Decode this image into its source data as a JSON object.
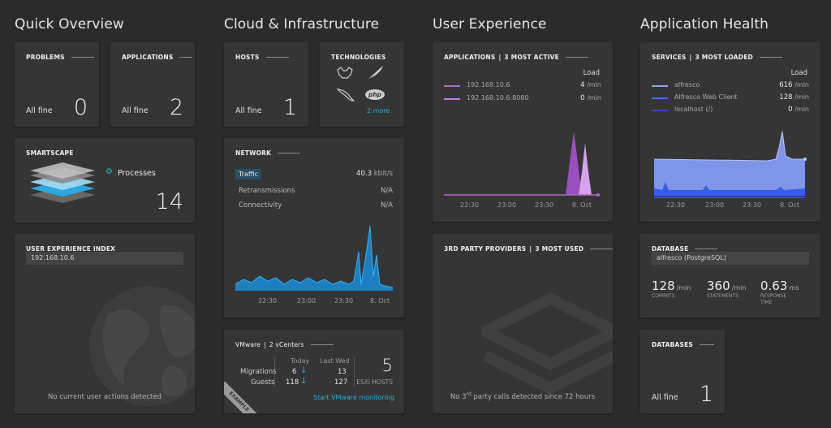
{
  "sections": {
    "quick_overview": "Quick Overview",
    "cloud": "Cloud & Infrastructure",
    "ux": "User Experience",
    "health": "Application Health"
  },
  "problems": {
    "title": "PROBLEMS",
    "status": "All fine",
    "count": "0"
  },
  "applications_count": {
    "title": "APPLICATIONS",
    "status": "All fine",
    "count": "2"
  },
  "smartscape": {
    "title": "SMARTSCAPE",
    "label": "Processes",
    "count": "14"
  },
  "uxi": {
    "title": "USER EXPERIENCE INDEX",
    "host": "192.168.10.6",
    "message": "No current user actions detected"
  },
  "hosts": {
    "title": "HOSTS",
    "status": "All fine",
    "count": "1"
  },
  "technologies": {
    "title": "TECHNOLOGIES",
    "more": "2 more",
    "php": "php"
  },
  "network": {
    "title": "NETWORK",
    "rows": [
      {
        "label": "Traffic",
        "value": "40.3",
        "unit": "kbit/s"
      },
      {
        "label": "Retransmissions",
        "value": "N/A",
        "unit": ""
      },
      {
        "label": "Connectivity",
        "value": "N/A",
        "unit": ""
      }
    ],
    "ticks": [
      "22:30",
      "23:00",
      "23:30",
      "8. Oct"
    ]
  },
  "vmware": {
    "title": "VMware",
    "subtitle": "2 vCenters",
    "col_today": "Today",
    "col_last": "Last Wed",
    "rows": [
      {
        "label": "Migrations",
        "today": "6",
        "last": "13"
      },
      {
        "label": "Guests",
        "today": "118",
        "last": "127"
      }
    ],
    "hosts_count": "5",
    "hosts_label": "ESXi HOSTS",
    "link": "Start VMware monitoring",
    "ribbon": "EXAMPLE"
  },
  "ux_apps": {
    "title": "APPLICATIONS",
    "subtitle": "3 MOST ACTIVE",
    "load_label": "Load",
    "rows": [
      {
        "name": "192.168.10.6",
        "value": "4",
        "unit": "/min",
        "color": "#b06ad0"
      },
      {
        "name": "192.168.10.6:8080",
        "value": "0",
        "unit": "/min",
        "color": "#c27fe0"
      }
    ],
    "ticks": [
      "22:30",
      "23:00",
      "23:30",
      "8. Oct"
    ]
  },
  "third_party": {
    "title": "3RD PARTY PROVIDERS",
    "subtitle": "3 MOST USED",
    "message_a": "No 3",
    "message_sup": "rd",
    "message_b": " party calls detected since 72 hours"
  },
  "services": {
    "title": "SERVICES",
    "subtitle": "3 MOST LOADED",
    "load_label": "Load",
    "rows": [
      {
        "name": "alfresco",
        "value": "616",
        "unit": "/min",
        "color": "#8ea2f2"
      },
      {
        "name": "Alfresco Web Client",
        "value": "128",
        "unit": "/min",
        "color": "#4a6ef0"
      },
      {
        "name": "localhost (/)",
        "value": "0",
        "unit": "/min",
        "color": "#3a3fc0"
      }
    ],
    "ticks": [
      "22:30",
      "23:00",
      "23:30",
      "8. Oct"
    ]
  },
  "database": {
    "title": "DATABASE",
    "name": "alfresco (PostgreSQL)",
    "metrics": [
      {
        "value": "128",
        "unit": "/min",
        "label": "COMMITS"
      },
      {
        "value": "360",
        "unit": "/min",
        "label": "STATEMENTS"
      },
      {
        "value": "0.63",
        "unit": "ms",
        "label": "RESPONSE TIME"
      }
    ]
  },
  "databases": {
    "title": "DATABASES",
    "status": "All fine",
    "count": "1"
  }
}
